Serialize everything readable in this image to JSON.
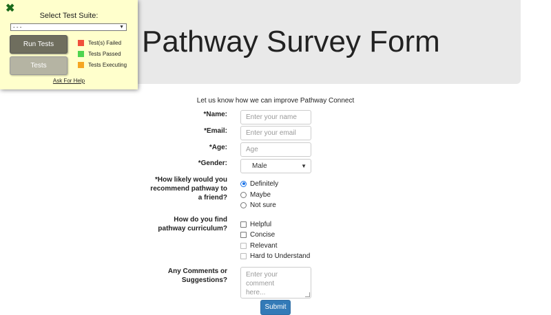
{
  "header": {
    "title": "Pathway Survey Form"
  },
  "intro": "Let us know how we can improve Pathway Connect",
  "form": {
    "name_label": "*Name:",
    "name_placeholder": "Enter your name",
    "email_label": "*Email:",
    "email_placeholder": "Enter your email",
    "age_label": "*Age:",
    "age_placeholder": "Age",
    "gender_label": "*Gender:",
    "gender_value": "Male",
    "recommend_label_line1": "*How likely would you",
    "recommend_label_line2": "recommend pathway to",
    "recommend_label_line3": "a friend?",
    "recommend_options": [
      "Definitely",
      "Maybe",
      "Not sure"
    ],
    "recommend_selected": "Definitely",
    "curriculum_label_line1": "How do you find",
    "curriculum_label_line2": "pathway curriculum?",
    "curriculum_options": [
      "Helpful",
      "Concise",
      "Relevant",
      "Hard to Understand"
    ],
    "comments_label_line1": "Any Comments or",
    "comments_label_line2": "Suggestions?",
    "comments_placeholder_line1": "Enter your comment",
    "comments_placeholder_line2": "here...",
    "submit_label": "Submit"
  },
  "test_panel": {
    "title": "Select Test Suite:",
    "suite_value": "- - -",
    "run_button": "Run Tests",
    "tests_button": "Tests",
    "legend": [
      {
        "label": "Test(s) Failed",
        "color": "#f0503c"
      },
      {
        "label": "Tests Passed",
        "color": "#4fd44f"
      },
      {
        "label": "Tests Executing",
        "color": "#f5a623"
      }
    ],
    "help_link": "Ask For Help",
    "close_icon_color": "#1a6a1a"
  },
  "colors": {
    "submit_bg": "#337ab7",
    "header_bg": "#e9e9e9",
    "panel_bg": "#ffffcc"
  }
}
